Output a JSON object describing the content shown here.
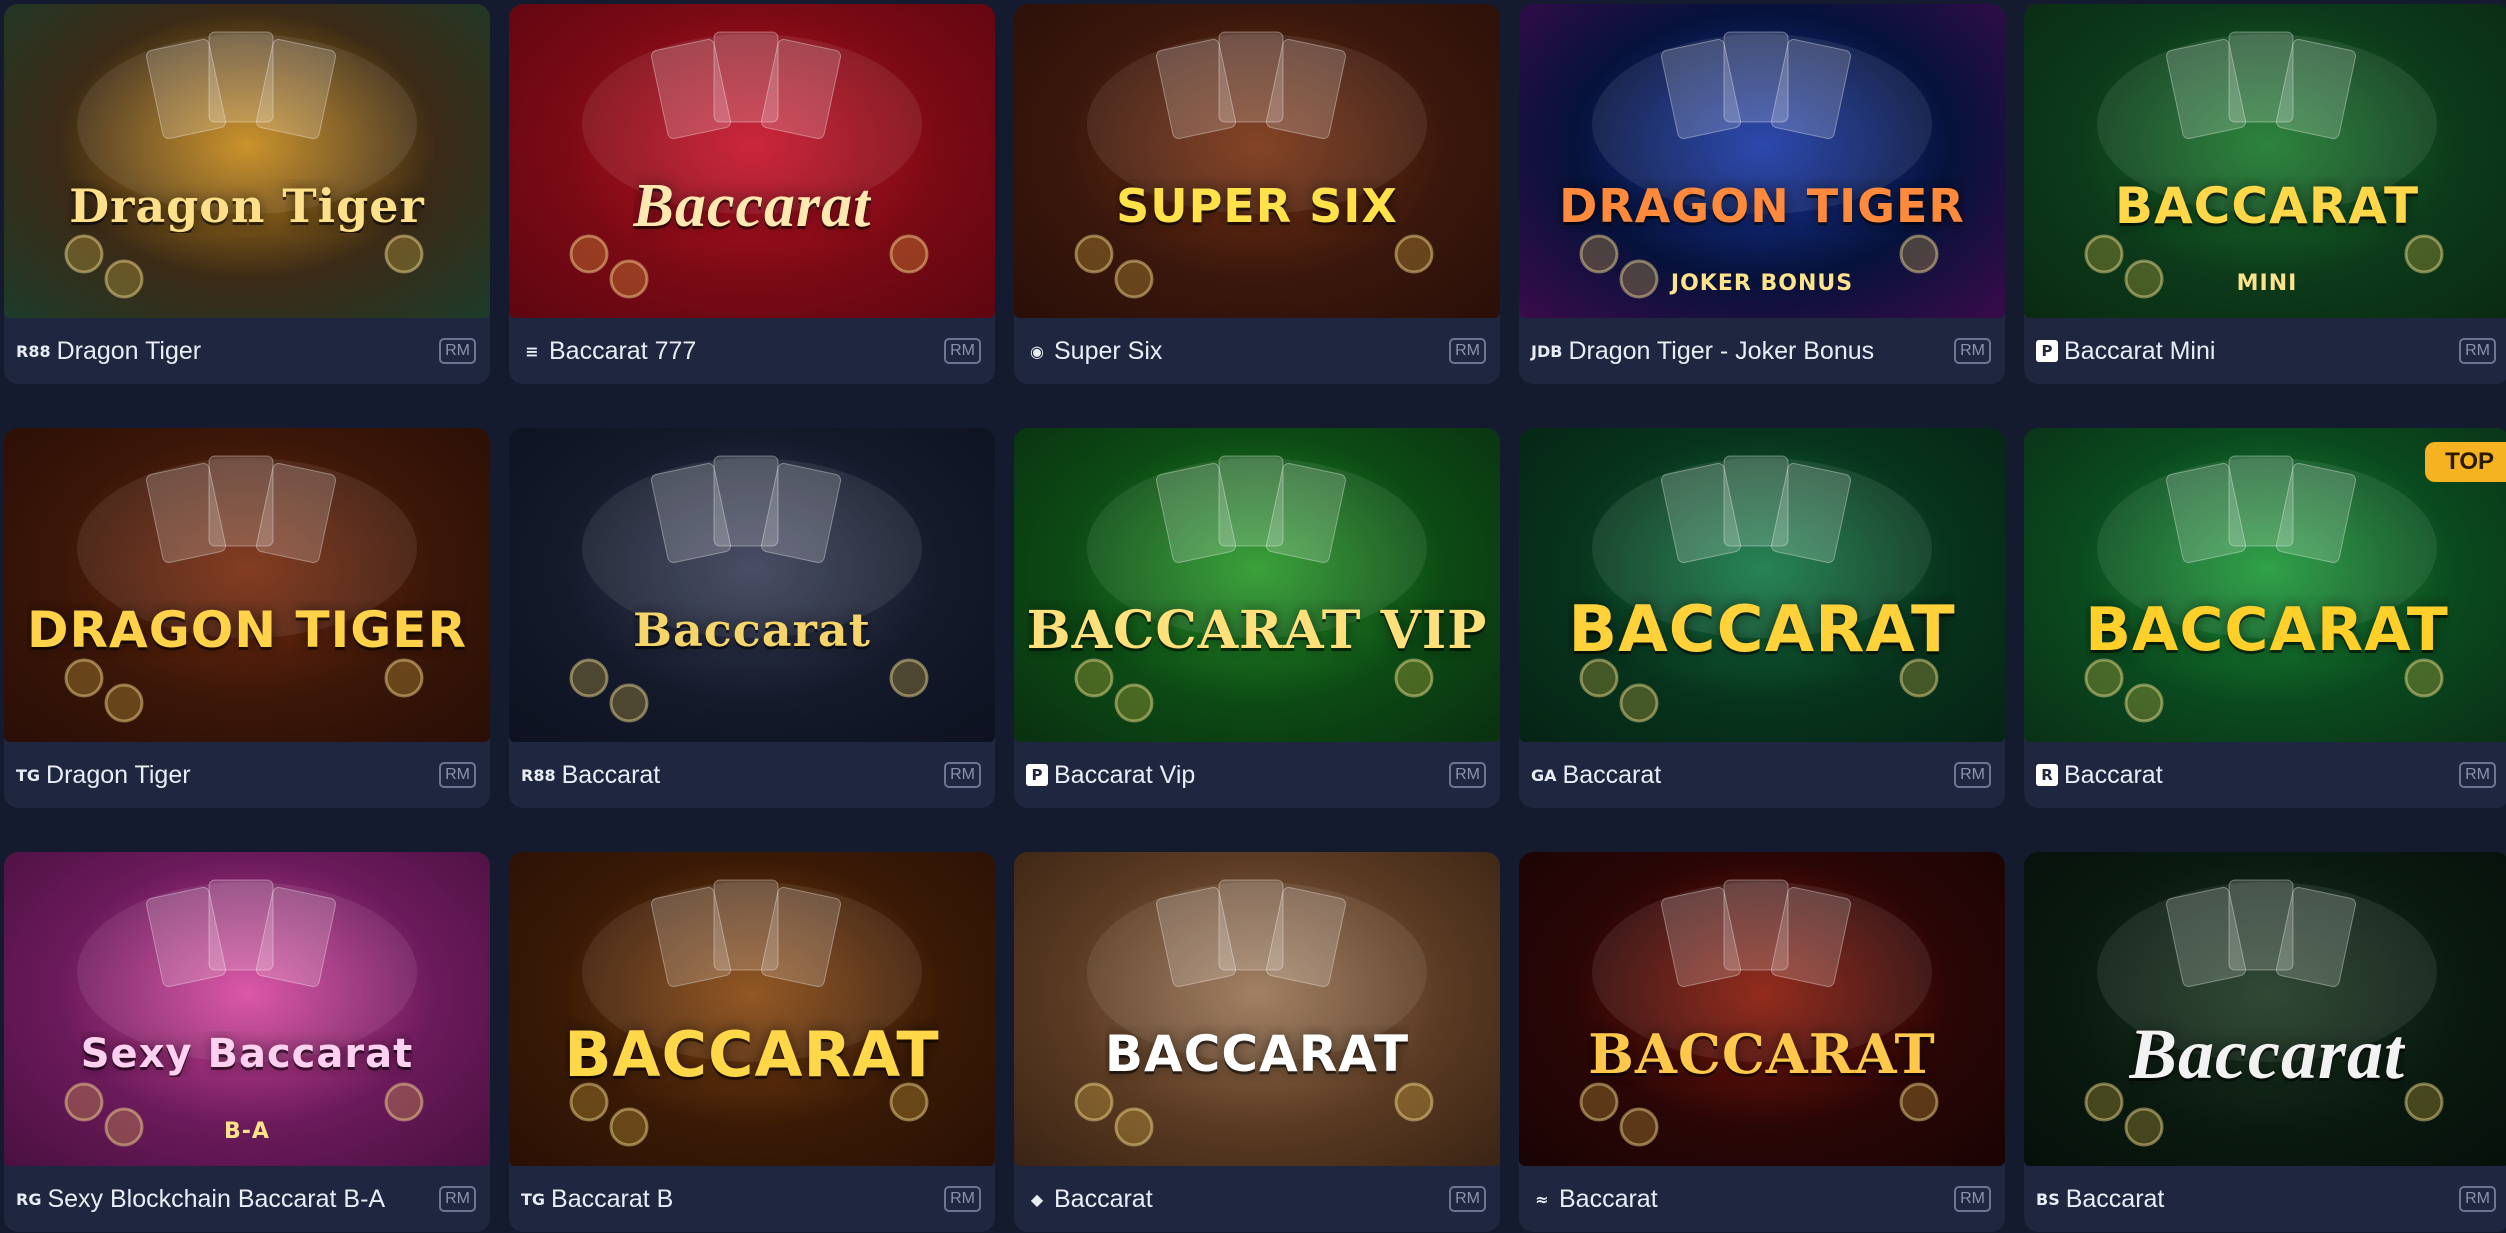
{
  "badge_label": "RM",
  "cards": [
    {
      "name": "Dragon Tiger",
      "provider": "R88",
      "art": "Dragon Tiger",
      "bg": [
        "#3b2a16",
        "#c78a1a",
        "#1d3b2a"
      ],
      "art_color": "#ffe08a",
      "art_size": 46,
      "art_style": "serif"
    },
    {
      "name": "Baccarat 777",
      "provider": "≡",
      "art": "Baccarat",
      "bg": [
        "#7a0a14",
        "#c8142a",
        "#5e0610"
      ],
      "art_color": "#ffe9b0",
      "art_size": 62,
      "art_style": "script"
    },
    {
      "name": "Super Six",
      "provider": "◉",
      "art": "SUPER SIX",
      "bg": [
        "#3a170c",
        "#7a3414",
        "#2a0f08"
      ],
      "art_color": "#ffe14a",
      "art_size": 46,
      "art_style": "block"
    },
    {
      "name": "Dragon Tiger - Joker Bonus",
      "provider": "JDB",
      "art": "DRAGON TIGER",
      "art_sub": "JOKER BONUS",
      "bg": [
        "#06123a",
        "#1b3aa8",
        "#3a0b4a"
      ],
      "art_color": "#ff8a3c",
      "art_size": 46,
      "art_style": "block"
    },
    {
      "name": "Baccarat Mini",
      "provider": "P",
      "art": "BACCARAT",
      "art_sub": "MINI",
      "bg": [
        "#0c3a1a",
        "#1c7a2e",
        "#0a2a12"
      ],
      "art_color": "#ffd84a",
      "art_size": 50,
      "art_style": "block"
    },
    {
      "name": "Dragon Tiger",
      "provider": "TG",
      "art": "DRAGON TIGER",
      "bg": [
        "#3a1608",
        "#7a2d10",
        "#2a0e06"
      ],
      "art_color": "#ffd24a",
      "art_size": 50,
      "art_style": "block"
    },
    {
      "name": "Baccarat",
      "provider": "R88",
      "art": "Baccarat",
      "bg": [
        "#141a2a",
        "#3a3f58",
        "#0d1120"
      ],
      "art_color": "#f5d56a",
      "art_size": 46,
      "art_style": "serif"
    },
    {
      "name": "Baccarat Vip",
      "provider": "P",
      "art": "BACCARAT VIP",
      "bg": [
        "#0c4a14",
        "#2a9a2a",
        "#0a3010"
      ],
      "art_color": "#ffe07a",
      "art_size": 52,
      "art_style": "serif"
    },
    {
      "name": "Baccarat",
      "provider": "GA",
      "art": "BACCARAT",
      "bg": [
        "#07331c",
        "#157a46",
        "#062414"
      ],
      "art_color": "#ffd23a",
      "art_size": 64,
      "art_style": "block"
    },
    {
      "name": "Baccarat",
      "provider": "R",
      "art": "BACCARAT",
      "top_label": "TOP",
      "bg": [
        "#0a4a1e",
        "#1f9a3a",
        "#0a3016"
      ],
      "art_color": "#ffcf2a",
      "art_size": 60,
      "art_style": "block"
    },
    {
      "name": "Sexy Blockchain Baccarat B-A",
      "provider": "RG",
      "art": "Sexy Baccarat",
      "art_sub": "B-A",
      "bg": [
        "#6a1a5a",
        "#d94aa0",
        "#4a1040"
      ],
      "art_color": "#ffd1f0",
      "art_size": 40,
      "art_style": "block"
    },
    {
      "name": "Baccarat B",
      "provider": "TG",
      "art": "BACCARAT",
      "bg": [
        "#3a1a06",
        "#8a4a12",
        "#2a1004"
      ],
      "art_color": "#ffd84a",
      "art_size": 62,
      "art_style": "block"
    },
    {
      "name": "Baccarat",
      "provider": "◆",
      "art": "BACCARAT",
      "bg": [
        "#5a3a22",
        "#9a7656",
        "#3a2414"
      ],
      "art_color": "#ffffff",
      "art_size": 50,
      "art_style": "block"
    },
    {
      "name": "Baccarat",
      "provider": "≈",
      "art": "BACCARAT",
      "bg": [
        "#2a0606",
        "#8a1a0a",
        "#1a0404"
      ],
      "art_color": "#ffc84a",
      "art_size": 54,
      "art_style": "serif"
    },
    {
      "name": "Baccarat",
      "provider": "BS",
      "art": "Baccarat",
      "bg": [
        "#0a1a10",
        "#1f3a24",
        "#06100a"
      ],
      "art_color": "#f2f2f2",
      "art_size": 72,
      "art_style": "script"
    }
  ]
}
